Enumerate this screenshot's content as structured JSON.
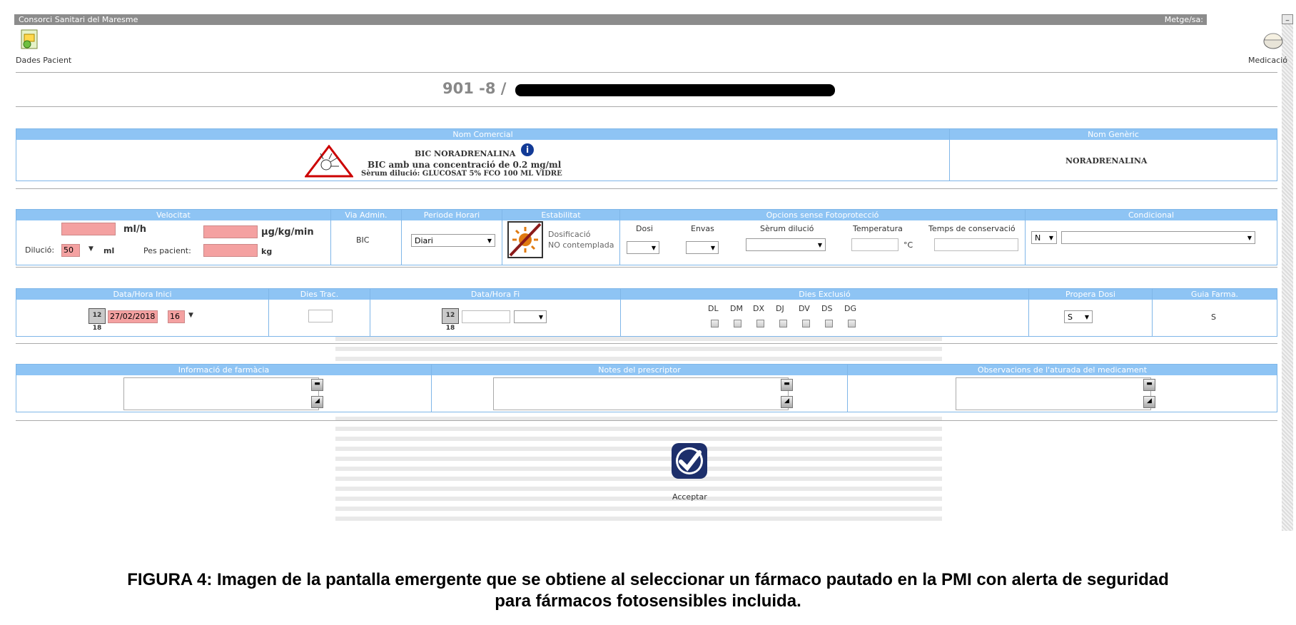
{
  "window": {
    "title": "Consorci Sanitari del Maresme",
    "doctor_label": "Metge/sa:",
    "minimize": "_"
  },
  "toolbar": {
    "patient_label": "Dades Pacient",
    "medication_label": "Medicació"
  },
  "patient": {
    "id": "901 -8 /"
  },
  "drug": {
    "header_commercial": "Nom Comercial",
    "header_generic": "Nom Genèric",
    "name": "BIC NORADRENALINA",
    "concentration": "BIC amb una concentració de 0.2 mg/ml",
    "diluent": "Sèrum dilució: GLUCOSAT 5% FCO 100 ML VIDRE",
    "generic": "NORADRENALINA",
    "info_icon": "i"
  },
  "dosage": {
    "h_velocitat": "Velocitat",
    "h_via": "Via Admin.",
    "h_periode": "Periode Horari",
    "h_estabilitat": "Estabilitat",
    "h_opcions": "Opcions sense Fotoprotecció",
    "h_condicional": "Condicional",
    "unit_mlh": "ml/h",
    "unit_ugkgmin": "µg/kg/min",
    "dilucio_label": "Dilució:",
    "dilucio_value": "50",
    "unit_ml": "ml",
    "pes_label": "Pes pacient:",
    "unit_kg": "kg",
    "via_value": "BIC",
    "periode_value": "Diari",
    "estab_text1": "Dosificació",
    "estab_text2": "NO contemplada",
    "col_dosi": "Dosi",
    "col_envas": "Envas",
    "col_serum": "Sèrum dilució",
    "col_temp": "Temperatura",
    "col_temps": "Temps de conservació",
    "temp_unit": "°C",
    "cond_value": "N"
  },
  "schedule": {
    "h_inici": "Data/Hora Inici",
    "h_dies_trac": "Dies Trac.",
    "h_fi": "Data/Hora Fi",
    "h_excl": "Dies Exclusió",
    "h_propera": "Propera Dosi",
    "h_guia": "Guia Farma.",
    "start_date": "27/02/2018",
    "start_hour": "16",
    "days": [
      "DL",
      "DM",
      "DX",
      "DJ",
      "DV",
      "DS",
      "DG"
    ],
    "propera_value": "S",
    "guia_value": "S",
    "cal_icon": "12 18"
  },
  "notes": {
    "h_info": "Informació de farmàcia",
    "h_notes": "Notes del prescriptor",
    "h_obs": "Observacions de l'aturada del medicament"
  },
  "accept": {
    "label": "Acceptar"
  },
  "caption": {
    "line1": "FIGURA 4: Imagen de la pantalla emergente que se obtiene al seleccionar un fármaco pautado en la PMI con alerta de seguridad",
    "line2": "para fármacos fotosensibles incluida."
  }
}
